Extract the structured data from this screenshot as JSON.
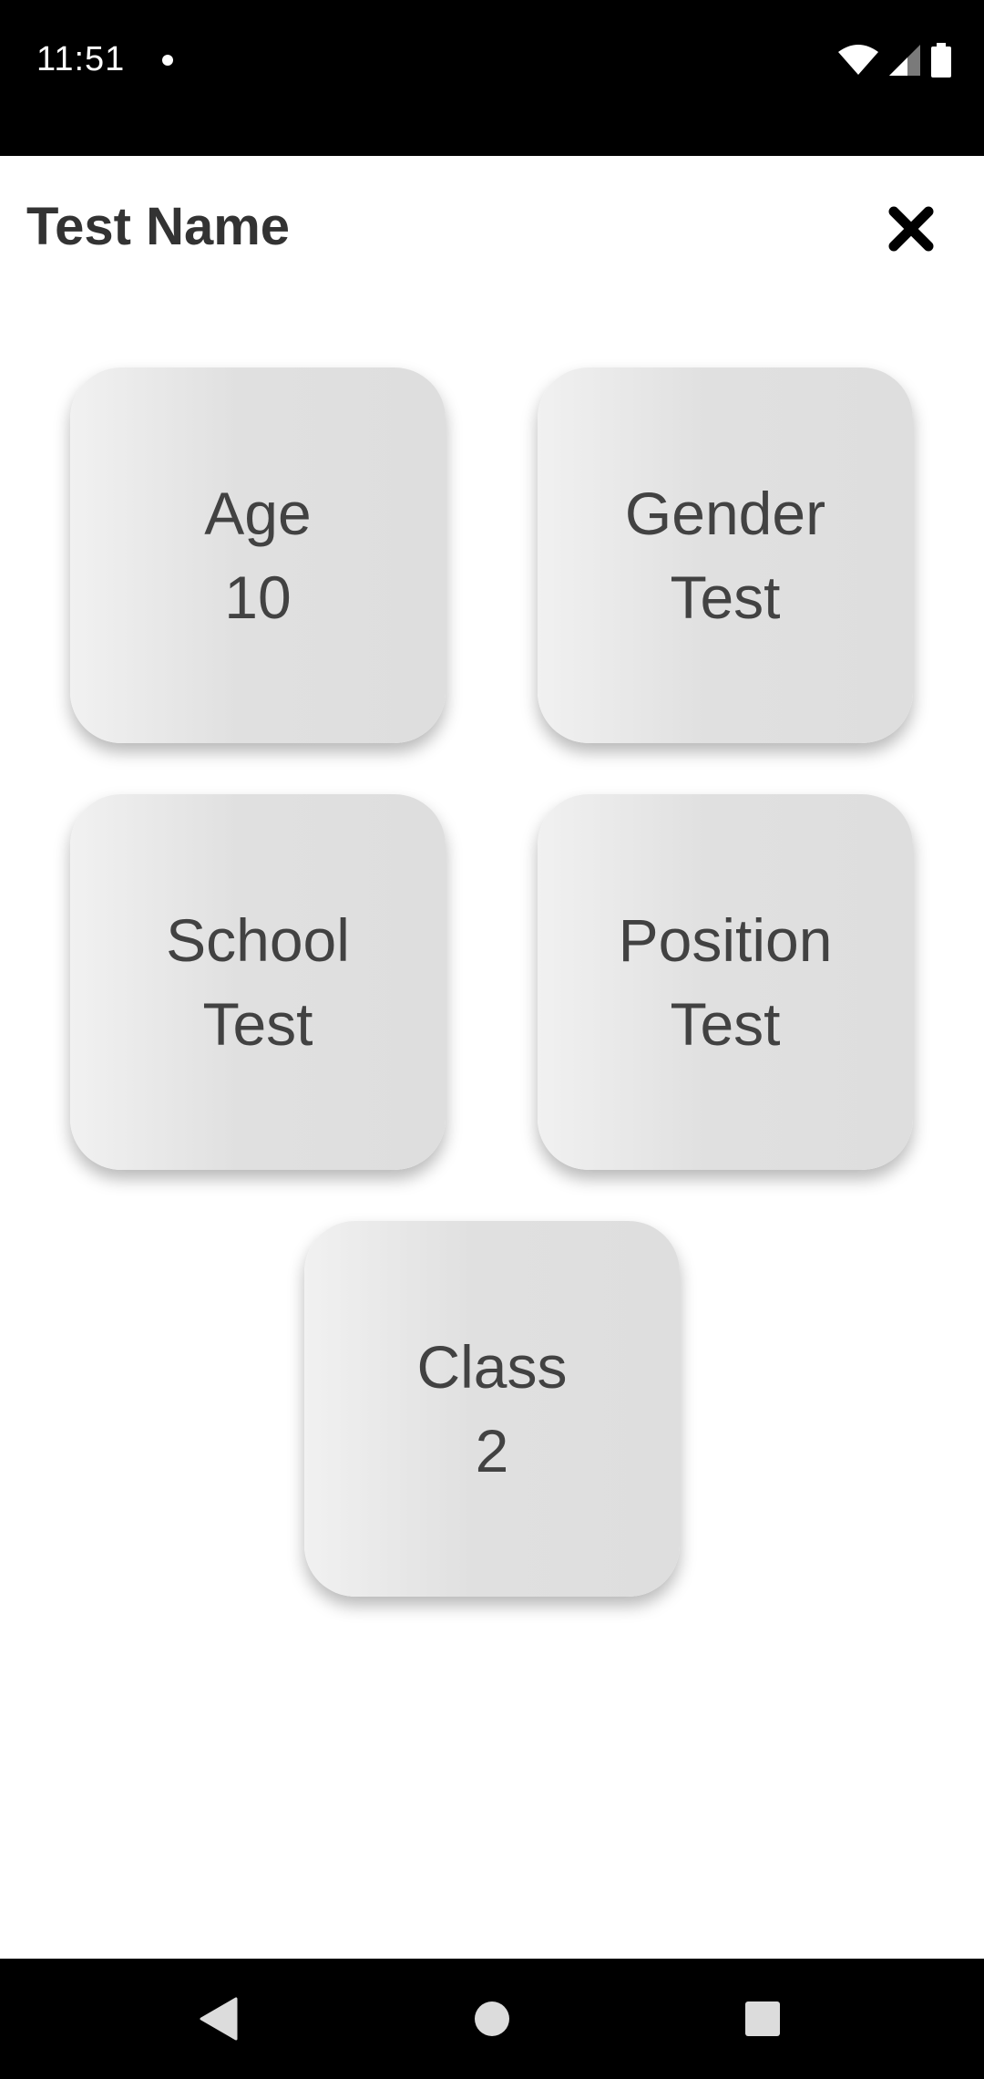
{
  "status_bar": {
    "time": "11:51",
    "icons": [
      "notification-dot-icon",
      "wifi-icon",
      "signal-icon",
      "battery-icon"
    ]
  },
  "header": {
    "title": "Test Name",
    "close_icon": "close-icon"
  },
  "tiles": [
    {
      "line1": "Age",
      "line2": "10"
    },
    {
      "line1": "Gender",
      "line2": "Test"
    },
    {
      "line1": "School",
      "line2": "Test"
    },
    {
      "line1": "Position",
      "line2": "Test"
    },
    {
      "line1": "Class",
      "line2": "2"
    }
  ],
  "nav_bar": {
    "icons": [
      "back-icon",
      "home-icon",
      "recents-icon"
    ]
  },
  "colors": {
    "status_bar": "#000000",
    "background": "#ffffff",
    "title_text": "#333333",
    "tile_text": "#424242",
    "tile_light": "#f1f1f1",
    "tile_dark": "#dedede"
  }
}
